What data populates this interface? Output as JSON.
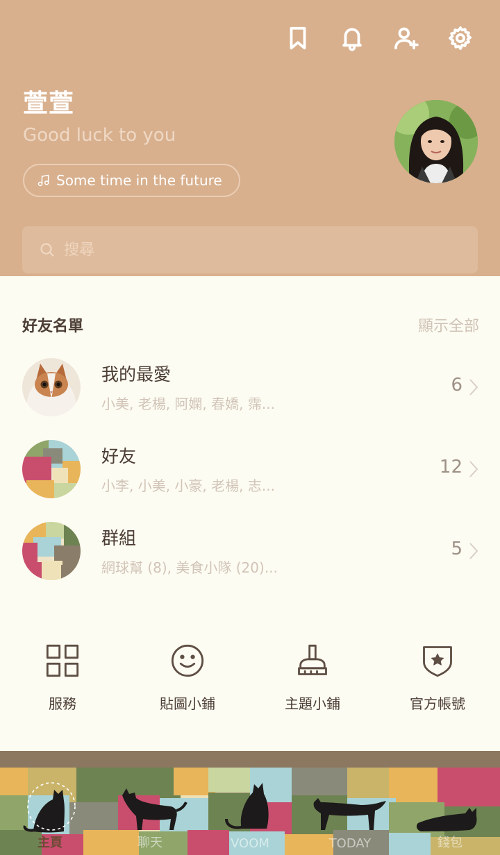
{
  "header": {
    "profile_name": "萱萱",
    "status_message": "Good luck to you",
    "music": "Some time in the future",
    "search_placeholder": "搜尋"
  },
  "top_icons": [
    "bookmark-icon",
    "bell-icon",
    "add-friend-icon",
    "settings-icon"
  ],
  "friends": {
    "title": "好友名單",
    "show_all": "顯示全部",
    "rows": [
      {
        "title": "我的最愛",
        "members": "小美, 老楊, 阿嫻, 春嬌, 霈...",
        "count": "6"
      },
      {
        "title": "好友",
        "members": "小李, 小美, 小豪, 老楊, 志...",
        "count": "12"
      },
      {
        "title": "群組",
        "members": "網球幫 (8), 美食小隊 (20)...",
        "count": "5"
      }
    ]
  },
  "quick_links": [
    {
      "label": "服務",
      "icon": "grid-icon"
    },
    {
      "label": "貼圖小鋪",
      "icon": "smiley-icon"
    },
    {
      "label": "主題小鋪",
      "icon": "brush-icon"
    },
    {
      "label": "官方帳號",
      "icon": "shield-star-icon"
    }
  ],
  "nav": {
    "tabs": [
      "主頁",
      "聊天",
      "VOOM",
      "TODAY",
      "錢包"
    ],
    "active": "主頁"
  },
  "colors": {
    "header_bg": "#D8B08E",
    "content_bg": "#FDFCF3",
    "text_dark": "#4B3D34",
    "text_light": "#D1C4B7"
  }
}
